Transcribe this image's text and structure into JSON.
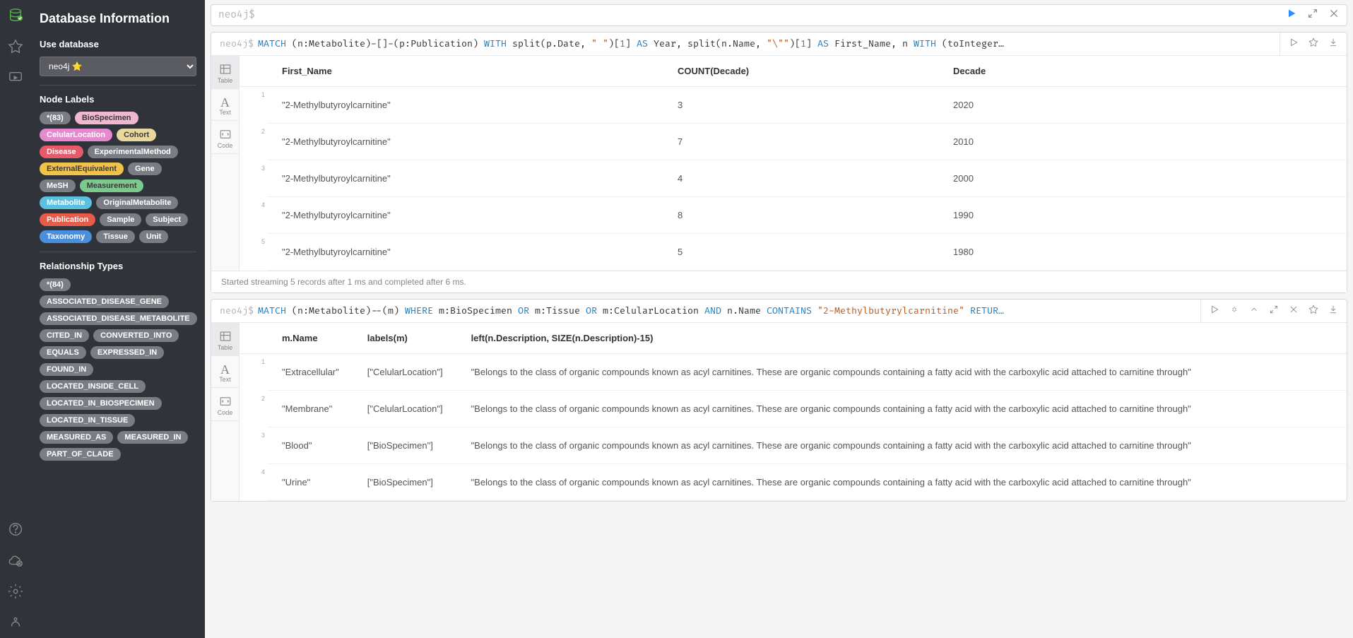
{
  "sidebar": {
    "title": "Database Information",
    "use_database_label": "Use database",
    "db_selected": "neo4j ⭐",
    "node_labels_heading": "Node Labels",
    "node_labels": [
      {
        "name": "*(83)",
        "bg": "#7a7d84",
        "fg": "#ffffff"
      },
      {
        "name": "BioSpecimen",
        "bg": "#f0b8d0",
        "fg": "#3a3a3a"
      },
      {
        "name": "CelularLocation",
        "bg": "#e68ad0",
        "fg": "#ffffff"
      },
      {
        "name": "Cohort",
        "bg": "#e8d89e",
        "fg": "#3a3a3a"
      },
      {
        "name": "Disease",
        "bg": "#e85a6a",
        "fg": "#ffffff"
      },
      {
        "name": "ExperimentalMethod",
        "bg": "#7a7d84",
        "fg": "#ffffff"
      },
      {
        "name": "ExternalEquivalent",
        "bg": "#f0c24a",
        "fg": "#3a3a3a"
      },
      {
        "name": "Gene",
        "bg": "#7a7d84",
        "fg": "#ffffff"
      },
      {
        "name": "MeSH",
        "bg": "#7a7d84",
        "fg": "#ffffff"
      },
      {
        "name": "Measurement",
        "bg": "#7cc98e",
        "fg": "#3a3a3a"
      },
      {
        "name": "Metabolite",
        "bg": "#5ac2e0",
        "fg": "#ffffff"
      },
      {
        "name": "OriginalMetabolite",
        "bg": "#7a7d84",
        "fg": "#ffffff"
      },
      {
        "name": "Publication",
        "bg": "#e85a4a",
        "fg": "#ffffff"
      },
      {
        "name": "Sample",
        "bg": "#7a7d84",
        "fg": "#ffffff"
      },
      {
        "name": "Subject",
        "bg": "#7a7d84",
        "fg": "#ffffff"
      },
      {
        "name": "Taxonomy",
        "bg": "#4a8ee0",
        "fg": "#ffffff"
      },
      {
        "name": "Tissue",
        "bg": "#7a7d84",
        "fg": "#ffffff"
      },
      {
        "name": "Unit",
        "bg": "#7a7d84",
        "fg": "#ffffff"
      }
    ],
    "rel_types_heading": "Relationship Types",
    "rel_types": [
      "*(84)",
      "ASSOCIATED_DISEASE_GENE",
      "ASSOCIATED_DISEASE_METABOLITE",
      "CITED_IN",
      "CONVERTED_INTO",
      "EQUALS",
      "EXPRESSED_IN",
      "FOUND_IN",
      "LOCATED_INSIDE_CELL",
      "LOCATED_IN_BIOSPECIMEN",
      "LOCATED_IN_TISSUE",
      "MEASURED_AS",
      "MEASURED_IN",
      "PART_OF_CLADE"
    ]
  },
  "editor": {
    "prompt": "neo4j$",
    "placeholder": ""
  },
  "frame1": {
    "prompt": "neo4j$",
    "query_parts": [
      {
        "t": "MATCH",
        "c": "kw"
      },
      {
        "t": " (n:Metabolite)-[]-(p:Publication) ",
        "c": ""
      },
      {
        "t": "WITH",
        "c": "kw"
      },
      {
        "t": " split(p.Date, ",
        "c": ""
      },
      {
        "t": "\" \"",
        "c": "str"
      },
      {
        "t": ")[",
        "c": ""
      },
      {
        "t": "1",
        "c": "str"
      },
      {
        "t": "] ",
        "c": ""
      },
      {
        "t": "AS",
        "c": "kw"
      },
      {
        "t": " Year, split(n.Name, ",
        "c": ""
      },
      {
        "t": "\"\\\"\"",
        "c": "str"
      },
      {
        "t": ")[",
        "c": ""
      },
      {
        "t": "1",
        "c": "str"
      },
      {
        "t": "] ",
        "c": ""
      },
      {
        "t": "AS",
        "c": "kw"
      },
      {
        "t": " First_Name, n ",
        "c": ""
      },
      {
        "t": "WITH",
        "c": "kw"
      },
      {
        "t": " (toInteger…",
        "c": ""
      }
    ],
    "columns": [
      "First_Name",
      "COUNT(Decade)",
      "Decade"
    ],
    "rows": [
      [
        "\"2-Methylbutyroylcarnitine\"",
        "3",
        "2020"
      ],
      [
        "\"2-Methylbutyroylcarnitine\"",
        "7",
        "2010"
      ],
      [
        "\"2-Methylbutyroylcarnitine\"",
        "4",
        "2000"
      ],
      [
        "\"2-Methylbutyroylcarnitine\"",
        "8",
        "1990"
      ],
      [
        "\"2-Methylbutyroylcarnitine\"",
        "5",
        "1980"
      ]
    ],
    "footer": "Started streaming 5 records after 1 ms and completed after 6 ms."
  },
  "frame2": {
    "prompt": "neo4j$",
    "query_parts": [
      {
        "t": "MATCH",
        "c": "kw"
      },
      {
        "t": " (n:Metabolite)--(m) ",
        "c": ""
      },
      {
        "t": "WHERE",
        "c": "kw"
      },
      {
        "t": " m:BioSpecimen ",
        "c": ""
      },
      {
        "t": "OR",
        "c": "kw"
      },
      {
        "t": " m:Tissue ",
        "c": ""
      },
      {
        "t": "OR",
        "c": "kw"
      },
      {
        "t": " m:CelularLocation ",
        "c": ""
      },
      {
        "t": "AND",
        "c": "kw"
      },
      {
        "t": " n.Name ",
        "c": ""
      },
      {
        "t": "CONTAINS",
        "c": "kw"
      },
      {
        "t": " ",
        "c": ""
      },
      {
        "t": "\"2-Methylbutyrylcarnitine\"",
        "c": "str"
      },
      {
        "t": " ",
        "c": ""
      },
      {
        "t": "RETUR…",
        "c": "kw"
      }
    ],
    "columns": [
      "m.Name",
      "labels(m)",
      "left(n.Description, SIZE(n.Description)-15)"
    ],
    "rows": [
      [
        "\"Extracellular\"",
        "[\"CelularLocation\"]",
        "\"Belongs to the class of organic compounds known as acyl carnitines. These are organic compounds containing a fatty acid with the carboxylic acid attached to carnitine through\""
      ],
      [
        "\"Membrane\"",
        "[\"CelularLocation\"]",
        "\"Belongs to the class of organic compounds known as acyl carnitines. These are organic compounds containing a fatty acid with the carboxylic acid attached to carnitine through\""
      ],
      [
        "\"Blood\"",
        "[\"BioSpecimen\"]",
        "\"Belongs to the class of organic compounds known as acyl carnitines. These are organic compounds containing a fatty acid with the carboxylic acid attached to carnitine through\""
      ],
      [
        "\"Urine\"",
        "[\"BioSpecimen\"]",
        "\"Belongs to the class of organic compounds known as acyl carnitines. These are organic compounds containing a fatty acid with the carboxylic acid attached to carnitine through\""
      ]
    ]
  },
  "view_tabs": {
    "table": "Table",
    "text": "Text",
    "code": "Code"
  }
}
